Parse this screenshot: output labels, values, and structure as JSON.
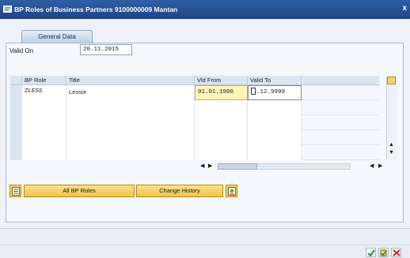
{
  "window": {
    "title": "BP Roles of Business Partners 9100000009 Mantan",
    "close_label": "x"
  },
  "tabs": [
    {
      "label": "General Data"
    }
  ],
  "valid_on": {
    "label": "Valid On",
    "value": "20.11.2015"
  },
  "table": {
    "columns": [
      "BP Role",
      "Title",
      "Vld From",
      "Valid To"
    ],
    "rows": [
      {
        "role": "ZLESS",
        "title": "Lessor",
        "valid_from": "01.01.1900",
        "valid_to": ".12.9999"
      }
    ],
    "empty_rows": 4
  },
  "buttons": {
    "all_bp_roles": "All BP Roles",
    "change_history": "Change History"
  },
  "icons": {
    "title": "window-icon",
    "column_settings": "column-settings-icon",
    "select_all": "select-all-icon",
    "details": "details-icon",
    "confirm": "checkmark-icon",
    "new": "new-entry-icon",
    "cancel": "cancel-icon"
  },
  "colors": {
    "titlebar": "#2f5fa3",
    "button": "#f0c44a",
    "highlight": "#fff4b8",
    "highlight_border": "#e8a33a"
  }
}
